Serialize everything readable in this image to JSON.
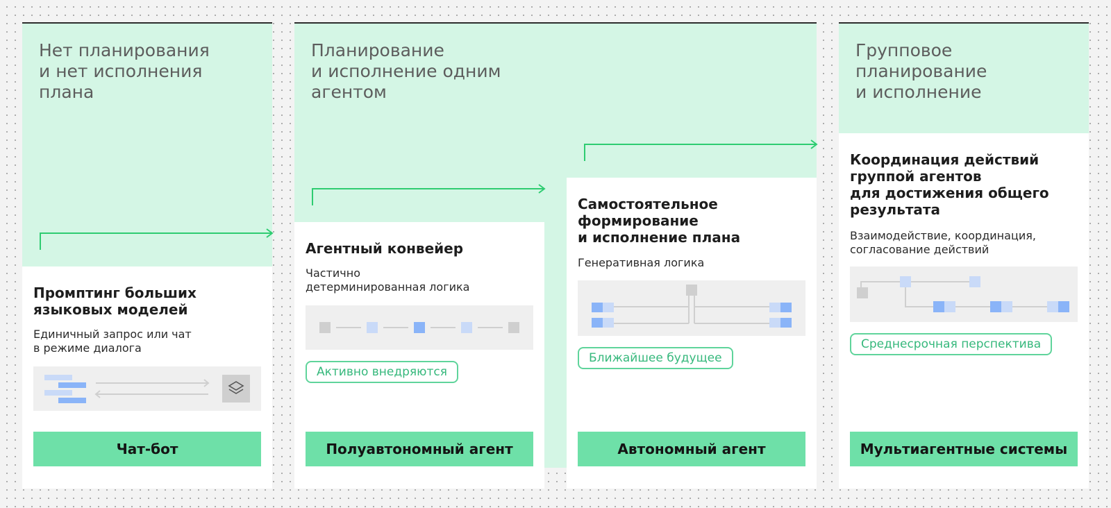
{
  "columns": [
    {
      "header": "Нет планирования\nи нет исполнения\nплана",
      "title": "Промптинг больших\nязыковых моделей",
      "subtitle": "Единичный запрос или чат\nв режиме диалога",
      "illustration_icon": "layers-icon",
      "badge": "",
      "footer": "Чат-бот"
    },
    {
      "header": "Планирование\nи исполнение одним\nагентом",
      "title": "Агентный конвейер",
      "subtitle": "Частично\nдетерминированная логика",
      "badge": "Активно внедряются",
      "footer": "Полуавтономный агент"
    },
    {
      "header": "",
      "title": "Самостоятельное\nформирование\nи исполнение плана",
      "subtitle": "Генеративная логика",
      "badge": "Ближайшее будущее",
      "footer": "Автономный агент"
    },
    {
      "header": "Групповое\nпланирование\nи исполнение",
      "title": "Координация действий\nгруппой агентов\nдля достижения общего\nрезультата",
      "subtitle": "Взаимодействие, координация,\nсогласование действий",
      "badge": "Среднесрочная перспектива",
      "footer": "Мультиагентные системы"
    }
  ],
  "colors": {
    "band": "#d4f6e5",
    "accent_line": "#2ecc71",
    "badge": "#5fd49b",
    "footer": "#6ee0a8",
    "node_blue": "#a9c6f5",
    "node_blue_dark": "#8ab4f8",
    "node_blue_light": "#c9daf8",
    "node_gray": "#cfcfcf"
  }
}
